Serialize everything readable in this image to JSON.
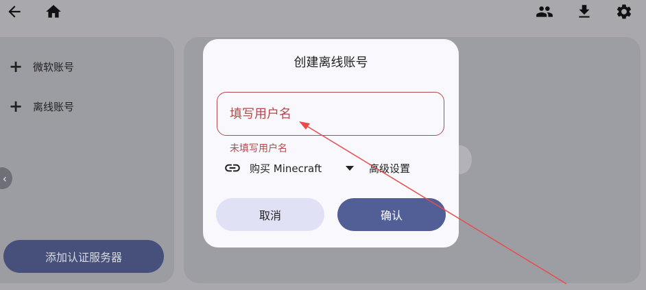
{
  "topbar": {
    "icons": [
      "back-arrow-icon",
      "home-icon",
      "people-icon",
      "download-icon",
      "settings-gear-icon"
    ]
  },
  "sidebar": {
    "items": [
      {
        "label": "微软账号",
        "icon": "plus-icon"
      },
      {
        "label": "离线账号",
        "icon": "plus-icon"
      }
    ],
    "add_server_label": "添加认证服务器",
    "collapse_glyph": "‹"
  },
  "dialog": {
    "title": "创建离线账号",
    "username_placeholder": "填写用户名",
    "username_value": "",
    "error_text": "未填写用户名",
    "buy_label": "购买 Minecraft",
    "advanced_label": "高级设置",
    "cancel_label": "取消",
    "confirm_label": "确认"
  },
  "annotation": {
    "color": "#e94b4b"
  },
  "colors": {
    "error": "#b5484b",
    "primary": "#525e96",
    "secondary": "#e1e1f5",
    "overlay": "#a9a9ad"
  }
}
